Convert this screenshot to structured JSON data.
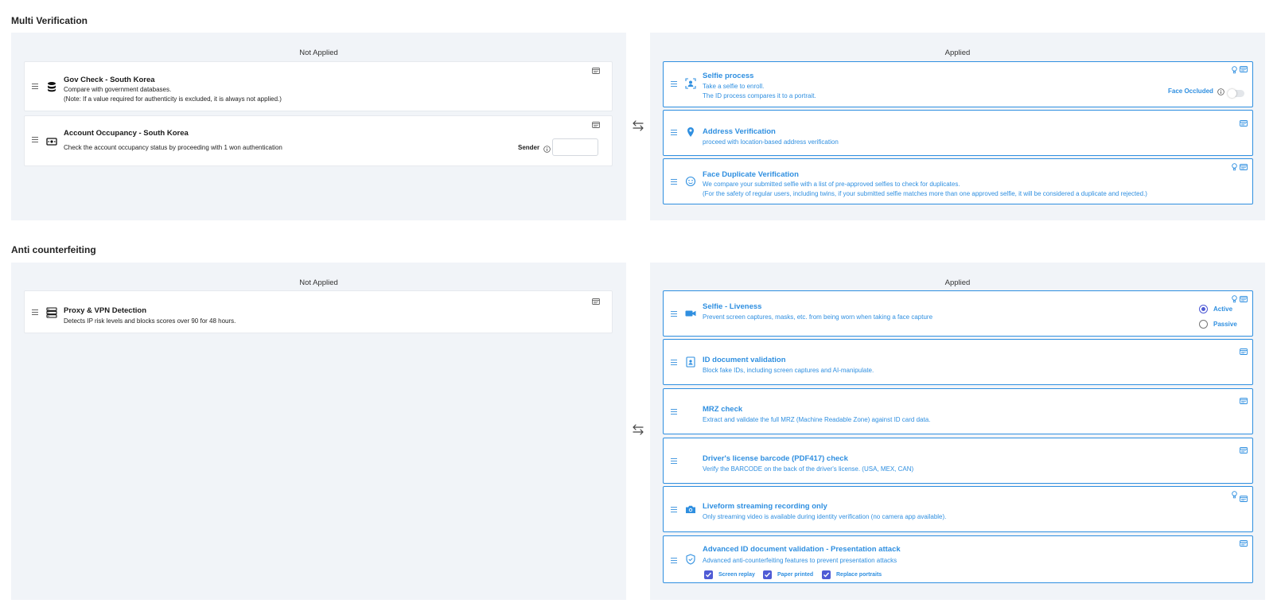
{
  "colors": {
    "accent": "#2f8fe0",
    "panel_bg": "#f1f4f8",
    "radio_checkbox": "#4f5bd5"
  },
  "multi_verification": {
    "title": "Multi Verification",
    "not_applied": {
      "title": "Not Applied",
      "items": [
        {
          "icon": "database-icon",
          "title": "Gov Check - South Korea",
          "desc1": "Compare with government databases.",
          "desc2": "(Note: If a value required for authenticity is excluded, it is always not applied.)"
        },
        {
          "icon": "money-icon",
          "title": "Account Occupancy - South Korea",
          "desc1": "Check the account occupancy status by proceeding with 1 won authentication",
          "sender_label": "Sender",
          "sender_value": ""
        }
      ]
    },
    "applied": {
      "title": "Applied",
      "items": [
        {
          "icon": "user-frame-icon",
          "title": "Selfie process",
          "desc1": "Take a selfie to enroll.",
          "desc2": "The ID process compares it to a portrait.",
          "toggle_label": "Face Occluded"
        },
        {
          "icon": "location-pin-icon",
          "title": "Address Verification",
          "desc1": "proceed with location-based address verification"
        },
        {
          "icon": "smiley-icon",
          "title": "Face Duplicate Verification",
          "desc1": "We compare your submitted selfie with a list of pre-approved selfies to check for duplicates.",
          "desc2": "(For the safety of regular users, including twins, if your submitted selfie matches more than one approved selfie, it will be considered a duplicate and rejected.)"
        }
      ]
    }
  },
  "anti_counterfeiting": {
    "title": "Anti counterfeiting",
    "not_applied": {
      "title": "Not Applied",
      "items": [
        {
          "icon": "server-list-icon",
          "title": "Proxy & VPN Detection",
          "desc1": "Detects IP risk levels and blocks scores over 90 for 48 hours."
        }
      ]
    },
    "applied": {
      "title": "Applied",
      "items": [
        {
          "icon": "video-camera-icon",
          "title": "Selfie - Liveness",
          "desc1": "Prevent screen captures, masks, etc. from being worn when taking a face capture",
          "radio_active": "Active",
          "radio_passive": "Passive"
        },
        {
          "icon": "id-badge-icon",
          "title": "ID document validation",
          "desc1": "Block fake IDs, including screen captures and AI-manipulate."
        },
        {
          "icon": "",
          "title": "MRZ check",
          "desc1": "Extract and validate the full MRZ (Machine Readable Zone) against ID card data."
        },
        {
          "icon": "",
          "title": "Driver's license barcode (PDF417) check",
          "desc1": "Verify the BARCODE on the back of the driver's license. (USA, MEX, CAN)"
        },
        {
          "icon": "camera-icon",
          "title": "Liveform streaming recording only",
          "desc1": "Only streaming video is available during identity verification (no camera app available)."
        },
        {
          "icon": "shield-icon",
          "title": "Advanced ID document validation - Presentation attack",
          "desc1": "Advanced anti-counterfeiting features to prevent presentation attacks",
          "cb1": "Screen replay",
          "cb2": "Paper printed",
          "cb3": "Replace portraits"
        }
      ]
    }
  }
}
